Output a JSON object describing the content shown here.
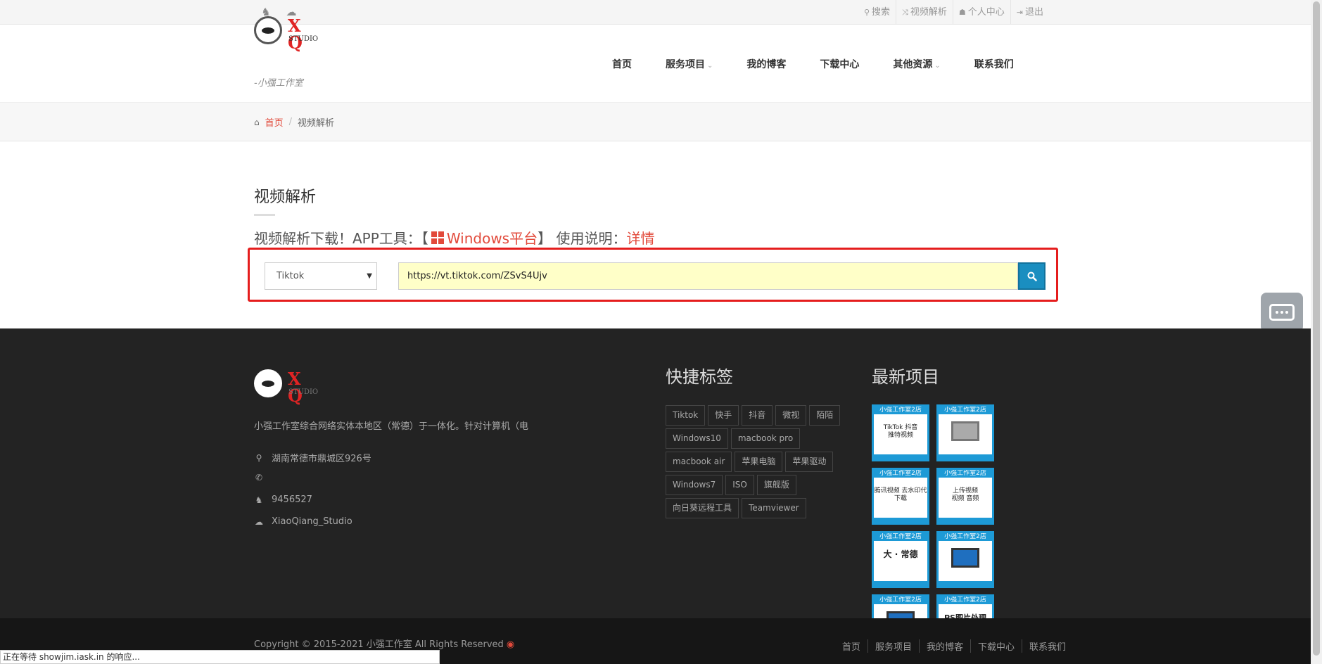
{
  "topbar": {
    "left_icons": [
      "qq-icon",
      "wechat-icon"
    ],
    "links": [
      {
        "icon": "search-icon",
        "label": "搜索"
      },
      {
        "icon": "shuffle-icon",
        "label": "视频解析"
      },
      {
        "icon": "users-icon",
        "label": "个人中心"
      },
      {
        "icon": "logout-icon",
        "label": "退出"
      }
    ]
  },
  "logo": {
    "xq": "X Q",
    "studio": "STUDIO",
    "tagline": "-小强工作室"
  },
  "nav": {
    "items": [
      {
        "label": "首页"
      },
      {
        "label": "服务项目",
        "caret": "⌄"
      },
      {
        "label": "我的博客"
      },
      {
        "label": "下载中心"
      },
      {
        "label": "其他资源",
        "caret": "⌄"
      },
      {
        "label": "联系我们"
      }
    ]
  },
  "breadcrumb": {
    "home": "首页",
    "sep": "/",
    "current": "视频解析"
  },
  "main": {
    "title": "视频解析",
    "promo_prefix": "视频解析下载！APP工具：【",
    "promo_platform": "Windows平台",
    "promo_mid": "】 使用说明：",
    "promo_link": "详情"
  },
  "form": {
    "selected_platform": "Tiktok",
    "url_value": "https://vt.tiktok.com/ZSvS4Ujv"
  },
  "footer": {
    "description": "小强工作室综合网络实体本地区（常德）于一体化。针对计算机（电",
    "address": "湖南常德市鼎城区926号",
    "phone": "",
    "qq": "9456527",
    "wechat": "XiaoQiang_Studio",
    "tags_title": "快捷标签",
    "tags": [
      [
        "Tiktok",
        "快手",
        "抖音",
        "微视",
        "陌陌"
      ],
      [
        "Windows10",
        "macbook pro"
      ],
      [
        "macbook air",
        "苹果电脑",
        "苹果驱动"
      ],
      [
        "Windows7",
        "ISO",
        "旗舰版"
      ],
      [
        "向日葵远程工具",
        "Teamviewer"
      ]
    ],
    "projects_title": "最新项目",
    "project_bar": "小强工作室2店",
    "projects": [
      {
        "text": "TikTok 抖音\n推特视频",
        "kind": "text"
      },
      {
        "text": "",
        "kind": "drive"
      },
      {
        "text": "腾讯视频 去水印代下载",
        "kind": "text"
      },
      {
        "text": "上传视频\n视频 音频",
        "kind": "text"
      },
      {
        "text": "大 · 常德",
        "kind": "text"
      },
      {
        "text": "",
        "kind": "monitor"
      },
      {
        "text": "",
        "kind": "monitor"
      },
      {
        "text": "PS图片处理",
        "kind": "text"
      }
    ]
  },
  "copyright": {
    "text": "Copyright © 2015-2021 小强工作室 All Rights Reserved",
    "links": [
      "首页",
      "服务项目",
      "我的博客",
      "下载中心",
      "联系我们"
    ]
  },
  "status_bar": "正在等待 showjim.iask.in 的响应...",
  "colors": {
    "accent": "#e24a3b",
    "button": "#1a8ec0",
    "highlight_border": "#e51d1d"
  }
}
